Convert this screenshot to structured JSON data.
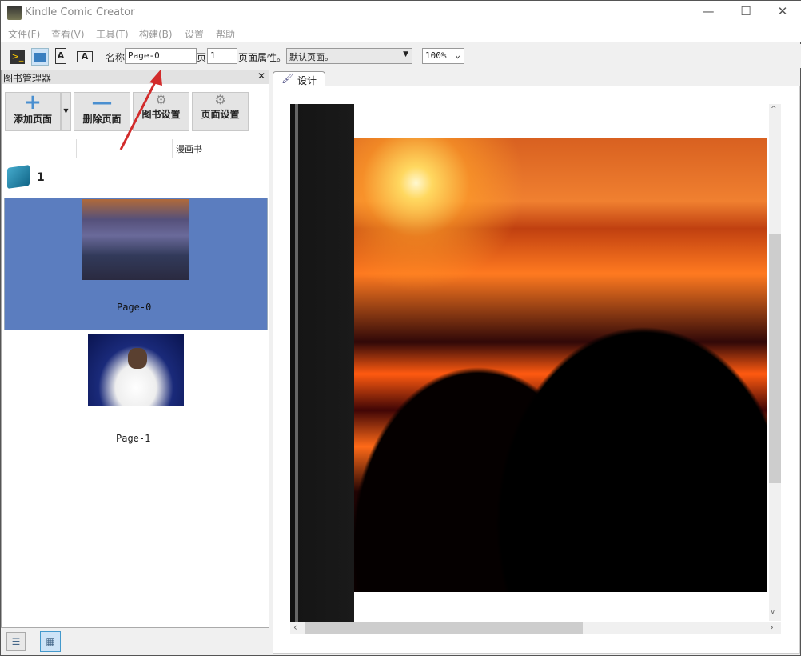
{
  "window": {
    "title": "Kindle Comic Creator",
    "minimize": "—",
    "maximize": "☐",
    "close": "✕"
  },
  "menu": [
    "文件(F)",
    "查看(V)",
    "工具(T)",
    "构建(B)",
    "设置",
    "帮助"
  ],
  "toolbar": {
    "name_label": "名称",
    "name_value": "Page-0",
    "page_label": "页",
    "page_value": "1",
    "props_label": "页面属性。",
    "props_value": "默认页面。",
    "zoom_value": "100%"
  },
  "book_manager": {
    "title": "图书管理器",
    "close": "✕",
    "buttons": {
      "add": "添加页面",
      "delete": "删除页面",
      "book_settings": "图书设置",
      "page_settings": "页面设置"
    },
    "column": "漫画书",
    "book_name": "1",
    "pages": [
      {
        "label": "Page-0",
        "selected": true
      },
      {
        "label": "Page-1",
        "selected": false
      }
    ]
  },
  "tabs": [
    {
      "label": "设计"
    }
  ],
  "colors": {
    "selection": "#5b7dbf",
    "annotation_arrow": "#d22b2b"
  }
}
